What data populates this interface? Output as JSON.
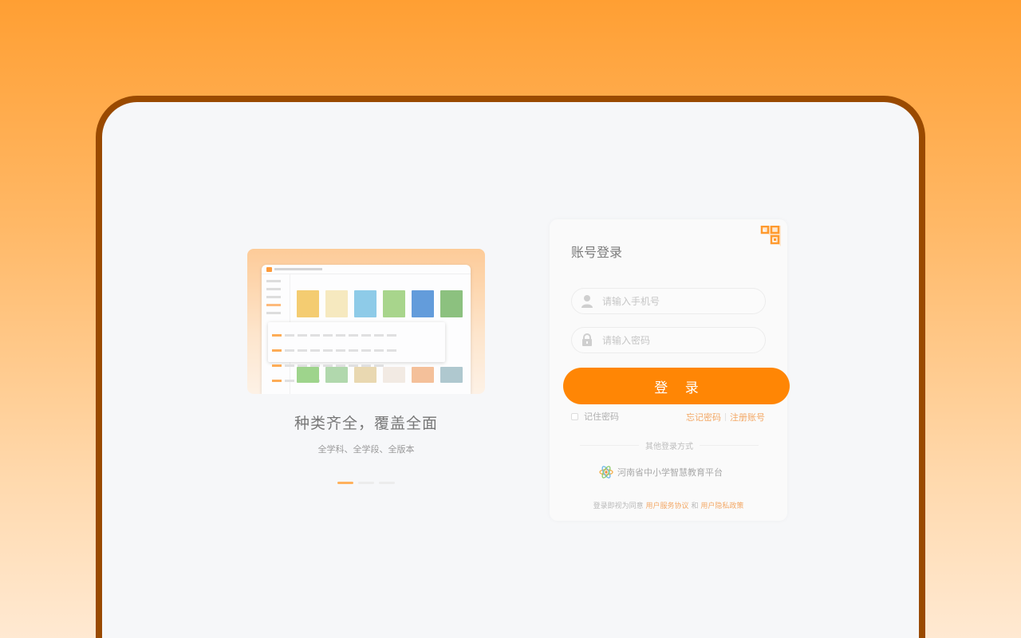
{
  "promo": {
    "mock_title": "河南省中小学智慧教育平台",
    "title": "种类齐全，覆盖全面",
    "subtitle": "全学科、全学段、全版本",
    "slide_count": 3,
    "active_slide": 1
  },
  "login": {
    "title": "账号登录",
    "phone_placeholder": "请输入手机号",
    "password_placeholder": "请输入密码",
    "login_button": "登 录",
    "remember_label": "记住密码",
    "forgot_link": "忘记密码",
    "register_link": "注册账号",
    "other_methods": "其他登录方式",
    "platform_name": "河南省中小学智慧教育平台",
    "agreement_prefix": "登录即视为同意",
    "service_agreement": "用户服务协议",
    "and": "和",
    "privacy_policy": "用户隐私政策"
  },
  "colors": {
    "accent": "#ff8605",
    "link": "#f3a866",
    "frame": "#9a4a00"
  },
  "icons": {
    "phone_field": "user-icon",
    "password_field": "lock-icon",
    "corner": "qr-code-icon",
    "platform": "platform-logo-icon"
  }
}
